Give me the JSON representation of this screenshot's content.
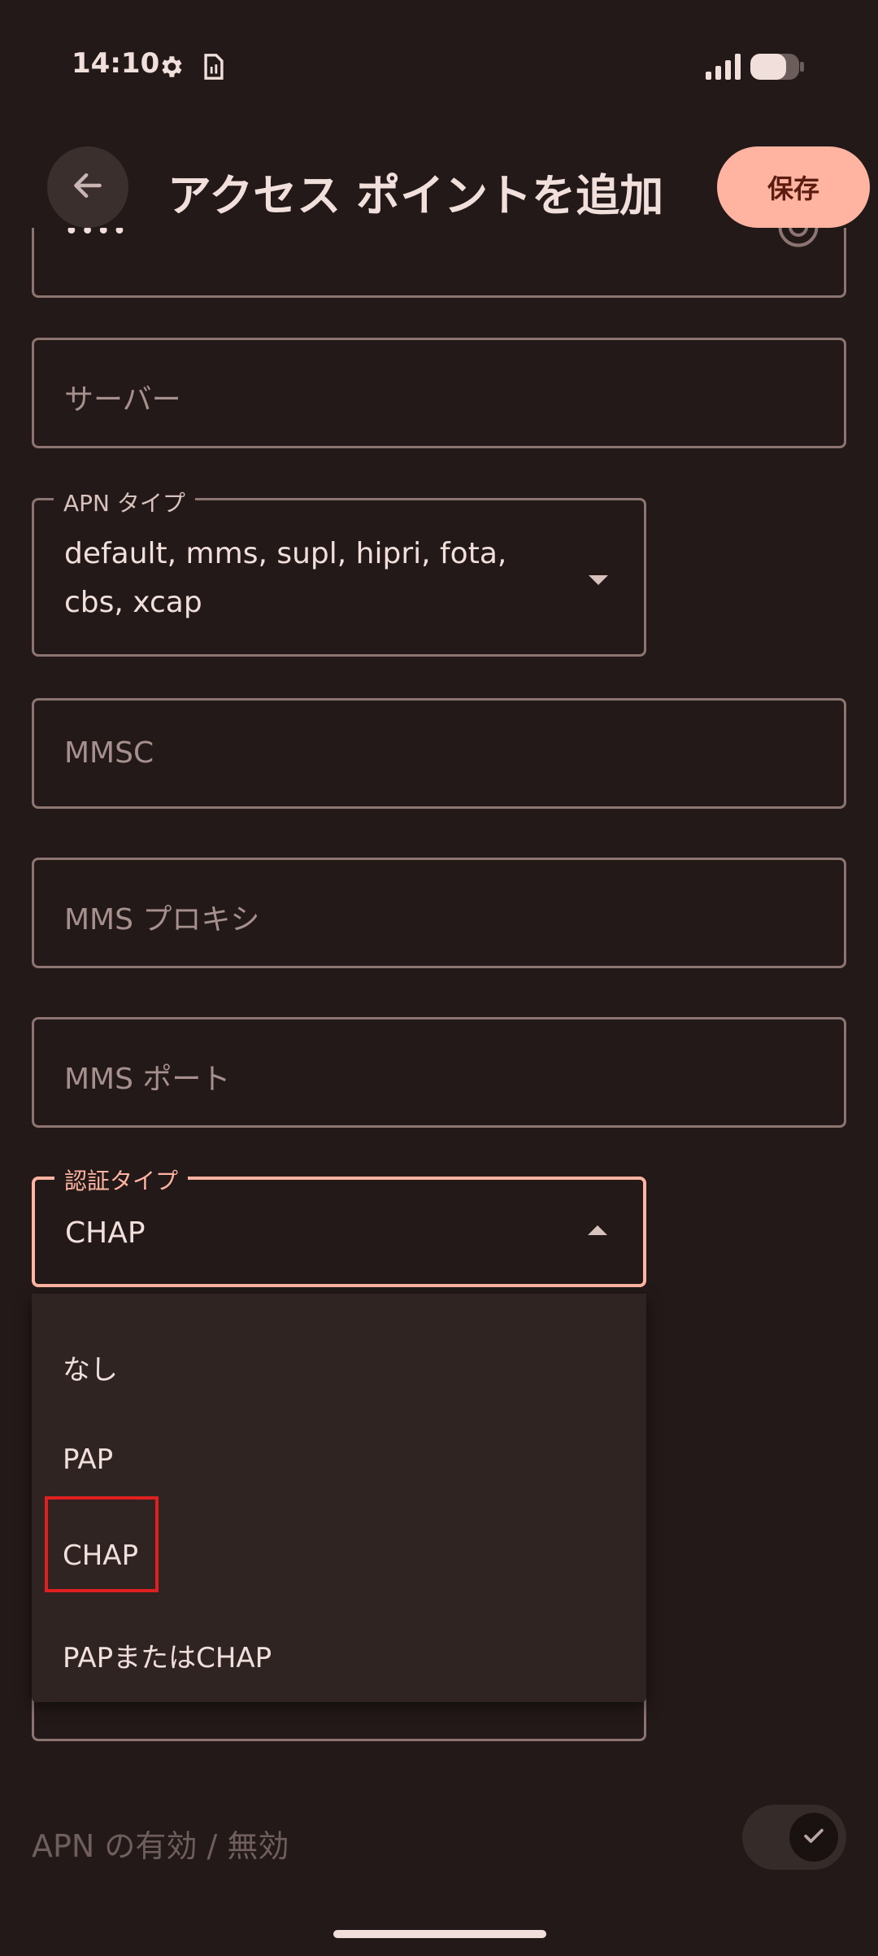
{
  "status_bar": {
    "time": "14:10"
  },
  "app_bar": {
    "title": "アクセス ポイントを追加",
    "save_label": "保存"
  },
  "fields": {
    "password_value": "••••",
    "server_placeholder": "サーバー",
    "apn_type_label": "APN タイプ",
    "apn_type_value_line1": "default, mms, supl, hipri, fota,",
    "apn_type_value_line2": "cbs, xcap",
    "mmsc_placeholder": "MMSC",
    "mms_proxy_placeholder": "MMS プロキシ",
    "mms_port_placeholder": "MMS ポート",
    "auth_type_label": "認証タイプ",
    "auth_type_value": "CHAP"
  },
  "auth_menu": {
    "options": [
      "なし",
      "PAP",
      "CHAP",
      "PAPまたはCHAP"
    ]
  },
  "apn_toggle": {
    "label": "APN の有効 / 無効",
    "enabled": true
  },
  "colors": {
    "accent": "#ffb4a2",
    "background": "#231918",
    "highlight": "#e02020"
  }
}
